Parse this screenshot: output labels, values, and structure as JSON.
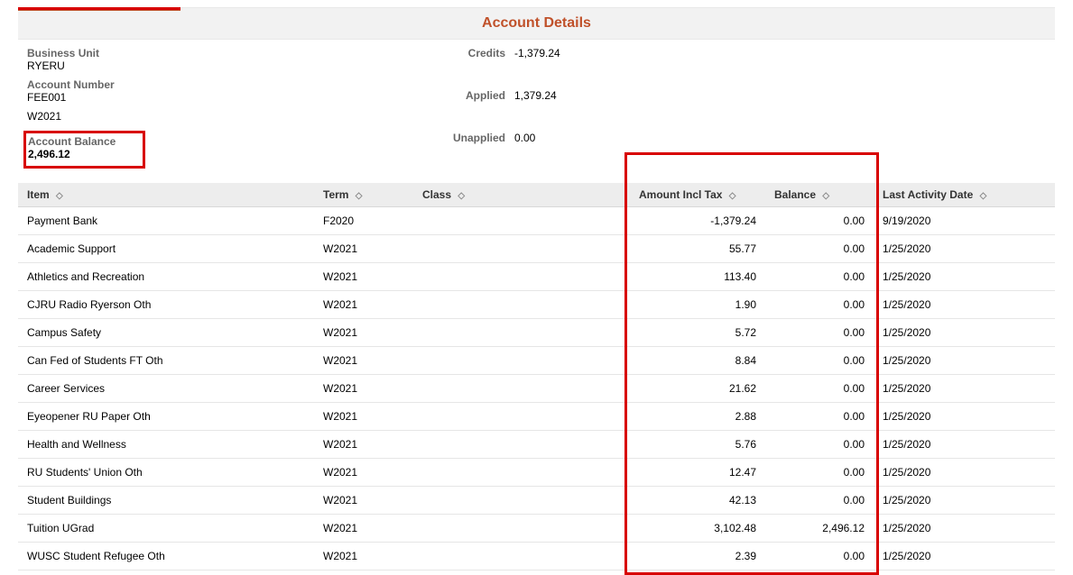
{
  "page": {
    "title": "Account Details"
  },
  "info": {
    "business_unit_label": "Business Unit",
    "business_unit_value": "RYERU",
    "account_number_label": "Account Number",
    "account_number_value": "FEE001",
    "term_value": "W2021",
    "account_balance_label": "Account Balance",
    "account_balance_value": "2,496.12"
  },
  "summary": {
    "credits_label": "Credits",
    "credits_value": "-1,379.24",
    "applied_label": "Applied",
    "applied_value": "1,379.24",
    "unapplied_label": "Unapplied",
    "unapplied_value": "0.00"
  },
  "columns": {
    "item": "Item",
    "term": "Term",
    "class": "Class",
    "amount_incl_tax": "Amount Incl Tax",
    "balance": "Balance",
    "last_activity_date": "Last Activity Date"
  },
  "rows": [
    {
      "item": "Payment Bank",
      "term": "F2020",
      "class": "",
      "amount": "-1,379.24",
      "balance": "0.00",
      "date": "9/19/2020"
    },
    {
      "item": "Academic Support",
      "term": "W2021",
      "class": "",
      "amount": "55.77",
      "balance": "0.00",
      "date": "1/25/2020"
    },
    {
      "item": "Athletics and Recreation",
      "term": "W2021",
      "class": "",
      "amount": "113.40",
      "balance": "0.00",
      "date": "1/25/2020"
    },
    {
      "item": "CJRU Radio Ryerson Oth",
      "term": "W2021",
      "class": "",
      "amount": "1.90",
      "balance": "0.00",
      "date": "1/25/2020"
    },
    {
      "item": "Campus Safety",
      "term": "W2021",
      "class": "",
      "amount": "5.72",
      "balance": "0.00",
      "date": "1/25/2020"
    },
    {
      "item": "Can Fed of Students FT Oth",
      "term": "W2021",
      "class": "",
      "amount": "8.84",
      "balance": "0.00",
      "date": "1/25/2020"
    },
    {
      "item": "Career Services",
      "term": "W2021",
      "class": "",
      "amount": "21.62",
      "balance": "0.00",
      "date": "1/25/2020"
    },
    {
      "item": "Eyeopener RU Paper Oth",
      "term": "W2021",
      "class": "",
      "amount": "2.88",
      "balance": "0.00",
      "date": "1/25/2020"
    },
    {
      "item": "Health and Wellness",
      "term": "W2021",
      "class": "",
      "amount": "5.76",
      "balance": "0.00",
      "date": "1/25/2020"
    },
    {
      "item": "RU Students' Union Oth",
      "term": "W2021",
      "class": "",
      "amount": "12.47",
      "balance": "0.00",
      "date": "1/25/2020"
    },
    {
      "item": "Student Buildings",
      "term": "W2021",
      "class": "",
      "amount": "42.13",
      "balance": "0.00",
      "date": "1/25/2020"
    },
    {
      "item": "Tuition UGrad",
      "term": "W2021",
      "class": "",
      "amount": "3,102.48",
      "balance": "2,496.12",
      "date": "1/25/2020"
    },
    {
      "item": "WUSC Student Refugee Oth",
      "term": "W2021",
      "class": "",
      "amount": "2.39",
      "balance": "0.00",
      "date": "1/25/2020"
    }
  ]
}
